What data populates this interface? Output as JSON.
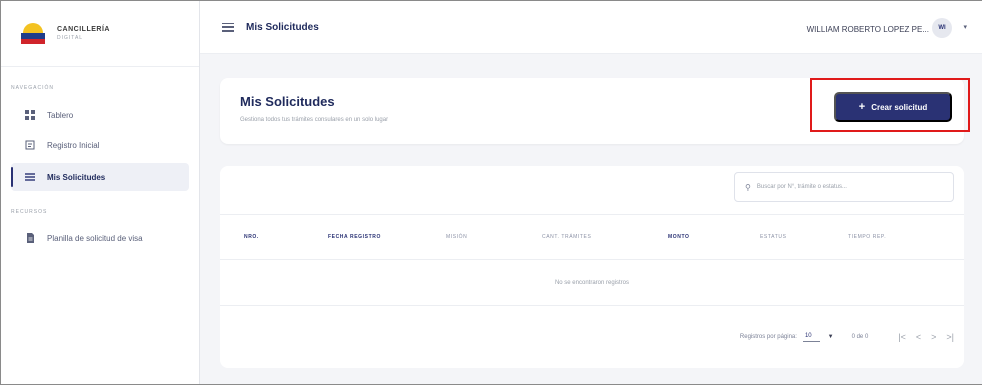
{
  "sidebar": {
    "brand_title": "CANCILLERÍA",
    "brand_sub": "DIGITAL",
    "section_nav": "NAVEGACIÓN",
    "section_resources": "RECURSOS",
    "items": [
      {
        "label": "Tablero",
        "icon": "dashboard-icon"
      },
      {
        "label": "Registro Inicial",
        "icon": "registration-icon"
      },
      {
        "label": "Mis Solicitudes",
        "icon": "list-icon",
        "active": true
      },
      {
        "label": "Planilla de solicitud de visa",
        "icon": "document-icon"
      }
    ]
  },
  "topbar": {
    "title": "Mis Solicitudes",
    "user_name": "WILLIAM ROBERTO LOPEZ PE...",
    "avatar_initials": "WI"
  },
  "header": {
    "title": "Mis Solicitudes",
    "subtitle": "Gestiona todos tus trámites consulares en un solo lugar",
    "create_button": "Crear solicitud"
  },
  "table": {
    "search_placeholder": "Buscar por N°, trámite o estatus...",
    "columns": [
      "NRO.",
      "FECHA REGISTRO",
      "MISIÓN",
      "CANT. TRÁMITES",
      "MONTO",
      "ESTATUS",
      "TIEMPO REP."
    ],
    "empty_message": "No se encontraron registros",
    "rows_per_page_label": "Registros por página:",
    "rows_per_page_value": "10",
    "range": "0 de 0"
  },
  "colors": {
    "primary": "#2a3274",
    "highlight": "#e01a1a",
    "background": "#f4f5f8"
  }
}
